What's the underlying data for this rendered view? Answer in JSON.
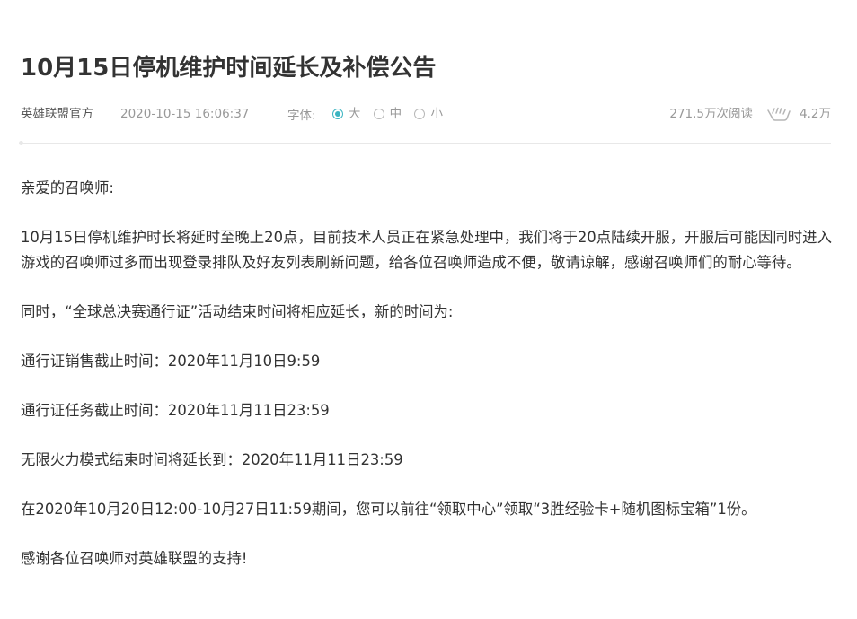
{
  "article": {
    "title": "10月15日停机维护时间延长及补偿公告",
    "author": "英雄联盟官方",
    "datetime": "2020-10-15 16:06:37",
    "font_label": "字体:",
    "font_options": [
      {
        "label": "大",
        "selected": true
      },
      {
        "label": "中",
        "selected": false
      },
      {
        "label": "小",
        "selected": false
      }
    ],
    "views": "271.5万次阅读",
    "likes": "4.2万",
    "paragraphs": [
      "亲爱的召唤师:",
      "10月15日停机维护时长将延时至晚上20点，目前技术人员正在紧急处理中，我们将于20点陆续开服，开服后可能因同时进入游戏的召唤师过多而出现登录排队及好友列表刷新问题，给各位召唤师造成不便，敬请谅解，感谢召唤师们的耐心等待。",
      "同时，“全球总决赛通行证”活动结束时间将相应延长，新的时间为:",
      "通行证销售截止时间：2020年11月10日9:59",
      "通行证任务截止时间：2020年11月11日23:59",
      "无限火力模式结束时间将延长到：2020年11月11日23:59",
      "在2020年10月20日12:00-10月27日11:59期间，您可以前往“领取中心”领取“3胜经验卡+随机图标宝箱”1份。",
      "感谢各位召唤师对英雄联盟的支持!"
    ]
  },
  "colors": {
    "accent": "#3bb4c1",
    "text": "#333333",
    "muted": "#999999"
  },
  "icons": {
    "like": "thumbs-up-icon"
  }
}
